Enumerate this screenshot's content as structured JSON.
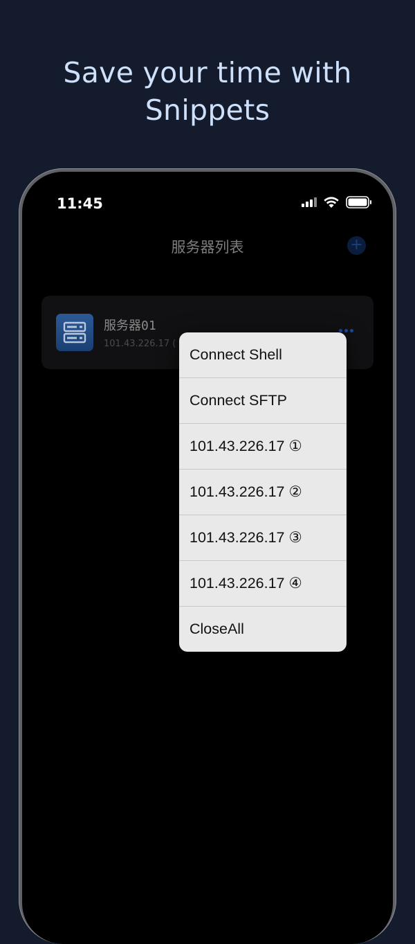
{
  "headline": {
    "line1": "Save your time with",
    "line2": "Snippets"
  },
  "status_bar": {
    "time": "11:45",
    "icons": [
      "cellular-signal-icon",
      "wifi-icon",
      "battery-icon"
    ]
  },
  "nav": {
    "title": "服务器列表",
    "add_icon": "+"
  },
  "server_list": [
    {
      "name": "服务器01",
      "ip": "101.43.226.17 ("
    }
  ],
  "popup_menu": {
    "items": [
      "Connect Shell",
      "Connect SFTP",
      "101.43.226.17 ①",
      "101.43.226.17 ②",
      "101.43.226.17 ③",
      "101.43.226.17 ④",
      "CloseAll"
    ]
  },
  "colors": {
    "background": "#141b2d",
    "headline": "#cfe0fa",
    "accent": "#1a4aa0",
    "menu_bg": "#e9e9ea"
  }
}
